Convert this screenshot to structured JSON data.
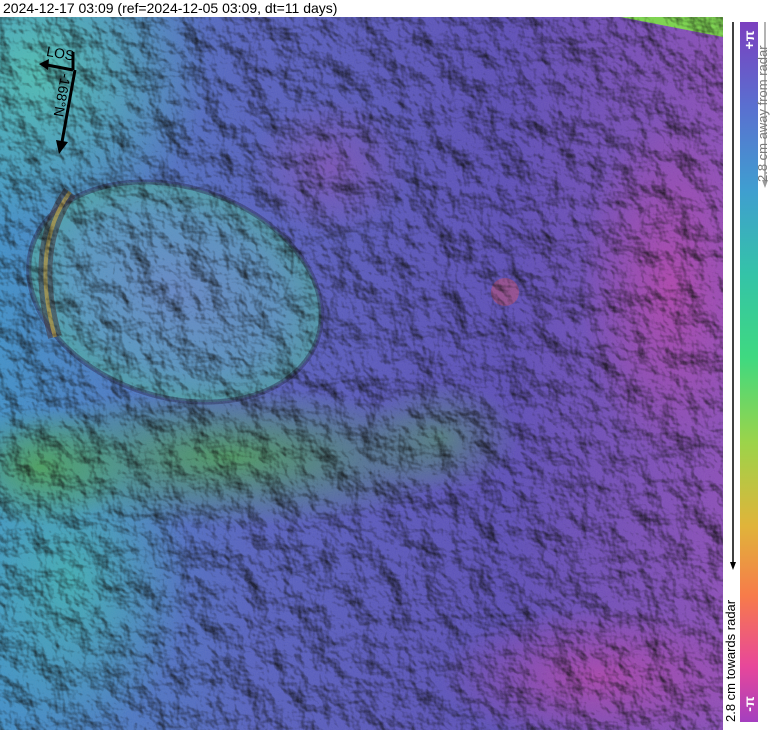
{
  "header": {
    "title": "2024-12-17 03:09 (ref=2024-12-05 03:09, dt=11 days)"
  },
  "map": {
    "los_label": "LOS",
    "heading_label": "-168°N",
    "icons": [
      "los-arrow-icon",
      "heading-arrow-icon"
    ]
  },
  "colorbar": {
    "top_label": "+π",
    "bottom_label": "-π",
    "away_label": "2.8 cm away from radar",
    "towards_label": "2.8 cm towards radar",
    "colors": [
      "#7b3fbf",
      "#5a6fd0",
      "#3f9ed0",
      "#34c3a8",
      "#3fd980",
      "#9bd44a",
      "#e0b43a",
      "#f77b4a",
      "#e8479a",
      "#a43fbf"
    ]
  }
}
